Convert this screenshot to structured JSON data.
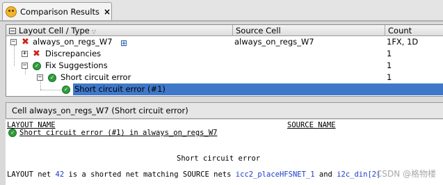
{
  "tab": {
    "title": "Comparison Results",
    "close": "×"
  },
  "columns": {
    "layout": "Layout Cell / Type",
    "source": "Source Cell",
    "count": "Count"
  },
  "tree": [
    {
      "label": "always_on_regs_W7",
      "source": "always_on_regs_W7",
      "count": "1FX, 1D",
      "expander": "−",
      "icon": "error-x"
    },
    {
      "label": "Discrepancies",
      "source": "",
      "count": "1",
      "expander": "+",
      "icon": "error-x"
    },
    {
      "label": "Fix Suggestions",
      "source": "",
      "count": "1",
      "expander": "−",
      "icon": "check"
    },
    {
      "label": "Short circuit error",
      "source": "",
      "count": "1",
      "expander": "−",
      "icon": "check"
    },
    {
      "label": "Short circuit error (#1)",
      "source": "",
      "count": "",
      "expander": "",
      "icon": "check"
    }
  ],
  "detail": {
    "title": "Cell always_on_regs_W7 (Short circuit error)",
    "layout_name_hdr": "LAYOUT NAME",
    "source_name_hdr": "SOURCE NAME",
    "item": "Short circuit error (#1) in always_on_regs_W7",
    "heading": "Short circuit error",
    "sentence_prefix": "LAYOUT net",
    "net_num": "42",
    "sentence_mid": "is a shorted net matching SOURCE nets",
    "net_a": "icc2_placeHFSNET_1",
    "and": "and",
    "net_b": "i2c_din[2]"
  },
  "watermark": "CSDN @格物楼"
}
